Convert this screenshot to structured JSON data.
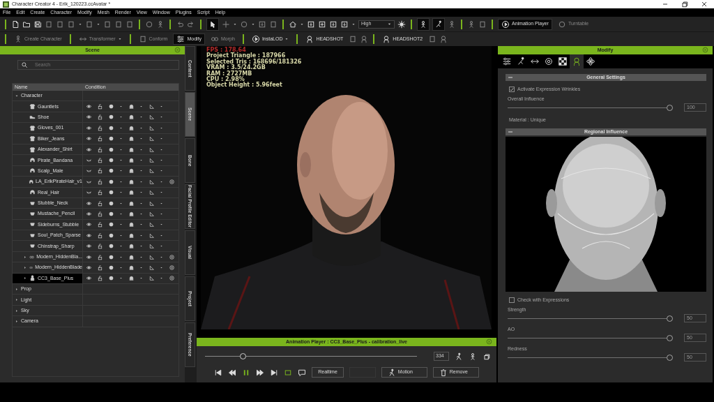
{
  "window": {
    "title": "Character Creator 4 - Erik_120223.ccAvatar *"
  },
  "menu": [
    "File",
    "Edit",
    "Create",
    "Character",
    "Modify",
    "Mesh",
    "Render",
    "View",
    "Window",
    "Plugins",
    "Script",
    "Help"
  ],
  "toolbar": {
    "quality": "High",
    "buttons": [
      {
        "label": "Animation Player",
        "disabled": false
      },
      {
        "label": "Turntable",
        "disabled": true
      }
    ]
  },
  "toolbar2": [
    {
      "label": "Create Character",
      "disabled": true,
      "selected": false
    },
    {
      "label": "Transformer",
      "disabled": true,
      "selected": false
    },
    {
      "label": "Conform",
      "disabled": true,
      "selected": false
    },
    {
      "label": "Modify",
      "disabled": false,
      "selected": true
    },
    {
      "label": "Morph",
      "disabled": true,
      "selected": false
    },
    {
      "label": "InstaLOD",
      "disabled": false,
      "selected": false
    },
    {
      "label": "HEADSHOT",
      "disabled": false,
      "selected": false
    },
    {
      "label": "HEADSHOT2",
      "disabled": false,
      "selected": false
    }
  ],
  "scene": {
    "title": "Scene",
    "search": {
      "placeholder": "Search"
    },
    "columns": [
      "Name",
      "Condition"
    ],
    "tree": [
      {
        "name": "Character",
        "expanded": true,
        "selected": false,
        "children": [
          {
            "name": "Gauntlets",
            "kind": "cloth",
            "visible": true,
            "extra_icon": false,
            "selected": false
          },
          {
            "name": "Shoe",
            "kind": "shoe",
            "visible": true,
            "extra_icon": false,
            "selected": false
          },
          {
            "name": "Gloves_001",
            "kind": "cloth",
            "visible": true,
            "extra_icon": false,
            "selected": false
          },
          {
            "name": "Biker_Jeans",
            "kind": "cloth",
            "visible": true,
            "extra_icon": false,
            "selected": false
          },
          {
            "name": "Alexander_Shirt",
            "kind": "cloth",
            "visible": true,
            "extra_icon": false,
            "selected": false
          },
          {
            "name": "Pirate_Bandana",
            "kind": "hair",
            "visible": false,
            "extra_icon": false,
            "selected": false
          },
          {
            "name": "Scalp_Male",
            "kind": "hair",
            "visible": false,
            "extra_icon": false,
            "selected": false
          },
          {
            "name": "LA_ErikPirateHair_v1",
            "kind": "hair",
            "visible": false,
            "extra_icon": true,
            "selected": false
          },
          {
            "name": "Real_Hair",
            "kind": "hair",
            "visible": false,
            "extra_icon": false,
            "selected": false
          },
          {
            "name": "Stubble_Neck",
            "kind": "beard",
            "visible": true,
            "extra_icon": false,
            "selected": false
          },
          {
            "name": "Mustache_Pencil",
            "kind": "beard",
            "visible": true,
            "extra_icon": false,
            "selected": false
          },
          {
            "name": "Sideburns_Stubble",
            "kind": "beard",
            "visible": true,
            "extra_icon": false,
            "selected": false
          },
          {
            "name": "Soul_Patch_Sparse",
            "kind": "beard",
            "visible": true,
            "extra_icon": false,
            "selected": false
          },
          {
            "name": "Chinstrap_Sharp",
            "kind": "beard",
            "visible": true,
            "extra_icon": false,
            "selected": false
          },
          {
            "name": "Modern_HiddenBla...",
            "kind": "link",
            "visible": true,
            "extra_icon": true,
            "selected": false,
            "expanded": false
          },
          {
            "name": "Modern_HiddenBlade",
            "kind": "link",
            "visible": true,
            "extra_icon": true,
            "selected": false,
            "expanded": false
          },
          {
            "name": "CC3_Base_Plus",
            "kind": "avatar",
            "visible": true,
            "extra_icon": true,
            "selected": true,
            "expanded": false
          }
        ]
      },
      {
        "name": "Prop",
        "expanded": false,
        "selected": false
      },
      {
        "name": "Light",
        "expanded": false,
        "selected": false
      },
      {
        "name": "Sky",
        "expanded": false,
        "selected": false
      },
      {
        "name": "Camera",
        "expanded": false,
        "selected": false
      }
    ]
  },
  "side_tabs": [
    {
      "label": "Content",
      "selected": false
    },
    {
      "label": "Scene",
      "selected": true
    },
    {
      "label": "Bone",
      "selected": false
    },
    {
      "label": "Facial Profile Editor",
      "selected": false
    },
    {
      "label": "Visual",
      "selected": false
    },
    {
      "label": "Project",
      "selected": false
    },
    {
      "label": "Preference",
      "selected": false
    }
  ],
  "viewport": {
    "stats": [
      {
        "text": "FPS : 178.64",
        "color": "#b22a2a"
      },
      {
        "text": "Project Triangle : 187966",
        "color": "#d8d8a8"
      },
      {
        "text": "Selected Tris : 168696/181326",
        "color": "#d8d8a8"
      },
      {
        "text": "VRAM : 3.5/24.2GB",
        "color": "#d8d8a8"
      },
      {
        "text": "RAM : 2727MB",
        "color": "#d8d8a8"
      },
      {
        "text": "CPU : 2.98%",
        "color": "#d8d8a8"
      },
      {
        "text": "Object Height : 5.96feet",
        "color": "#d8d8a8"
      }
    ]
  },
  "animation_player": {
    "title": "Animation Player : CC3_Base_Plus - calibration_live",
    "level": 0.17,
    "frame": "334",
    "playing": true,
    "buttons": [
      "Realtime",
      "Motion",
      "Remove"
    ]
  },
  "modify": {
    "title": "Modify",
    "disabled": true,
    "tabs": [
      {
        "selected": false
      },
      {
        "selected": false
      },
      {
        "selected": false
      },
      {
        "selected": false
      },
      {
        "selected": false
      },
      {
        "selected": true
      },
      {
        "selected": false
      }
    ],
    "general": {
      "title": "General Settings",
      "expanded": true,
      "checkbox": {
        "label": "Activate Expression Wrinkles",
        "checked": true
      },
      "slider": {
        "label": "Overall Influence",
        "level": 1,
        "value": "100"
      },
      "material": "Material : Unique"
    },
    "regional": {
      "title": "Regional Influence",
      "expanded": true,
      "checkbox": {
        "label": "Check with Expressions",
        "checked": false
      },
      "sliders": [
        {
          "label": "Strength",
          "level": 1,
          "value": "50"
        },
        {
          "label": "AO",
          "level": 1,
          "value": "50"
        },
        {
          "label": "Redness",
          "level": 1,
          "value": "50"
        }
      ]
    }
  }
}
